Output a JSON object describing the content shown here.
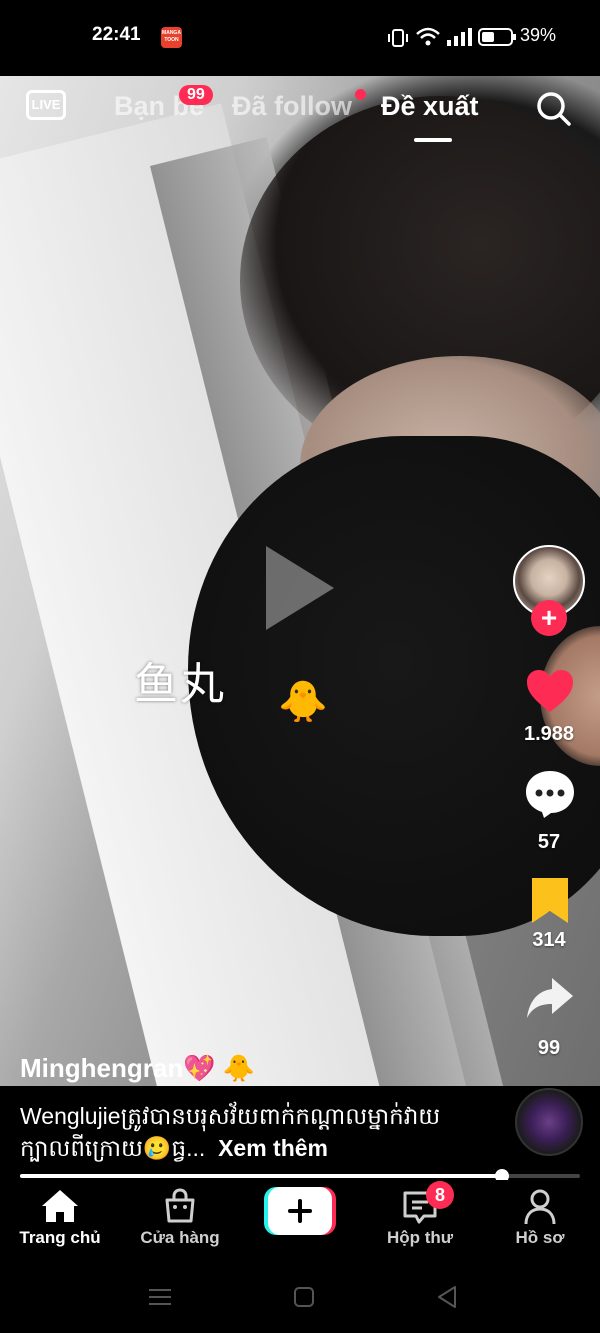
{
  "status_bar": {
    "time": "22:41",
    "app_icon_text": "MANGA TOON",
    "battery": "39%"
  },
  "top_nav": {
    "live_label": "LIVE",
    "tabs": [
      {
        "label": "Bạn bè",
        "badge": "99"
      },
      {
        "label": "Đã follow"
      },
      {
        "label": "Đề xuất",
        "active": true
      }
    ]
  },
  "video": {
    "overlay_text": "鱼丸",
    "overlay_emoji": "🐥",
    "paused": true
  },
  "actions": {
    "likes": "1.988",
    "comments": "57",
    "saves": "314",
    "shares": "99"
  },
  "post": {
    "username": "Minghengran💖 🐥",
    "caption": "Wenglujieត្រូវបានបរុសវ័យពាក់កណ្ដាលម្នាក់វាយក្បាលពីក្រោយ🥲ធ្វ...",
    "see_more": "Xem thêm",
    "progress": 0.86
  },
  "bottom_nav": {
    "items": [
      {
        "label": "Trang chủ",
        "active": true
      },
      {
        "label": "Cửa hàng"
      },
      {
        "label": ""
      },
      {
        "label": "Hộp thư",
        "badge": "8"
      },
      {
        "label": "Hồ sơ"
      }
    ]
  },
  "colors": {
    "accent": "#fe2c55",
    "save": "#fcc11a",
    "create_left": "#25f4ee"
  }
}
